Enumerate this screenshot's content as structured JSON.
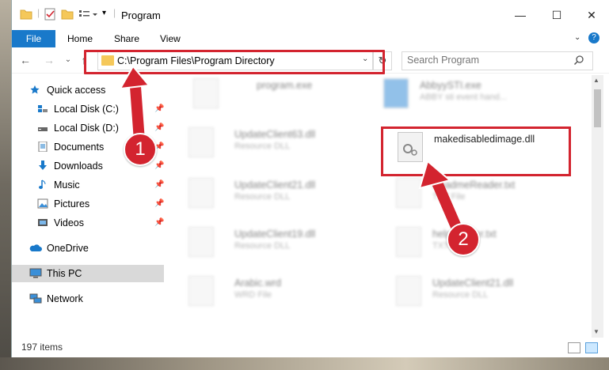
{
  "window": {
    "title": "Program",
    "controls": [
      "minimize",
      "maximize",
      "close"
    ]
  },
  "ribbon": {
    "file_label": "File",
    "tabs": [
      "Home",
      "Share",
      "View"
    ]
  },
  "navigation": {
    "address_path": "C:\\Program Files\\Program Directory",
    "search_placeholder": "Search Program"
  },
  "sidebar": {
    "items": [
      {
        "label": "Quick access",
        "icon": "star-icon",
        "pinned": false
      },
      {
        "label": "Local Disk (C:)",
        "icon": "drive-icon",
        "pinned": true
      },
      {
        "label": "Local Disk (D:)",
        "icon": "drive-icon",
        "pinned": true
      },
      {
        "label": "Documents",
        "icon": "documents-icon",
        "pinned": true
      },
      {
        "label": "Downloads",
        "icon": "download-icon",
        "pinned": true
      },
      {
        "label": "Music",
        "icon": "music-icon",
        "pinned": true
      },
      {
        "label": "Pictures",
        "icon": "pictures-icon",
        "pinned": true
      },
      {
        "label": "Videos",
        "icon": "videos-icon",
        "pinned": true
      },
      {
        "label": "OneDrive",
        "icon": "cloud-icon",
        "pinned": false
      },
      {
        "label": "This PC",
        "icon": "computer-icon",
        "pinned": false,
        "selected": true
      },
      {
        "label": "Network",
        "icon": "network-icon",
        "pinned": false
      }
    ]
  },
  "files": [
    {
      "name": "program.exe",
      "type": ""
    },
    {
      "name": "AbbyySTI.exe",
      "type": "ABBY sti event hand..."
    },
    {
      "name": "UpdateClient63.dll",
      "type": "Resource DLL"
    },
    {
      "name": "makedisabledimage.dll",
      "type": ""
    },
    {
      "name": "UpdateClient21.dll",
      "type": "Resource DLL"
    },
    {
      "name": "ReadmeReader.txt",
      "type": "TXT File"
    },
    {
      "name": "UpdateClient19.dll",
      "type": "Resource DLL"
    },
    {
      "name": "helpReader.txt",
      "type": "TXT File"
    },
    {
      "name": "Arabic.wrd",
      "type": "WRD File"
    },
    {
      "name": "UpdateClient21.dll",
      "type": "Resource DLL"
    }
  ],
  "status": {
    "items_count": "197 items"
  },
  "annotations": {
    "step1": "1",
    "step2": "2",
    "color": "#d3242f"
  },
  "colors": {
    "accent": "#1979ca",
    "highlight": "#d3242f",
    "folder": "#f5c85a"
  }
}
